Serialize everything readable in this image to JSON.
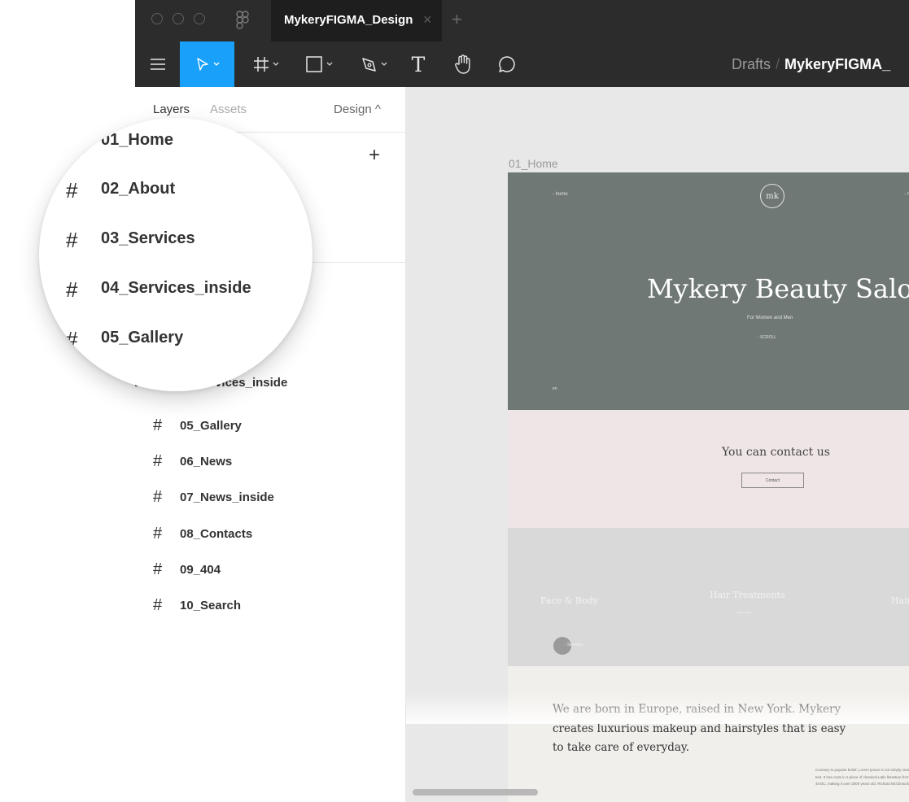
{
  "window": {
    "tab_title": "MykeryFIGMA_Design",
    "tab_close": "×",
    "tab_add": "+"
  },
  "toolbar": {
    "breadcrumb_parent": "Drafts",
    "breadcrumb_separator": "/",
    "breadcrumb_file": "MykeryFIGMA_",
    "text_tool_glyph": "T",
    "tools": [
      "menu-icon",
      "move-icon",
      "frame-icon",
      "shape-icon",
      "pen-icon",
      "text-icon",
      "hand-icon",
      "comment-icon"
    ]
  },
  "panel": {
    "tab_layers": "Layers",
    "tab_assets": "Assets",
    "tab_design": "Design ^",
    "add_page": "+"
  },
  "layers": [
    {
      "hash": "#",
      "label": "05_Gallery"
    },
    {
      "hash": "#",
      "label": "06_News"
    },
    {
      "hash": "#",
      "label": "07_News_inside"
    },
    {
      "hash": "#",
      "label": "08_Contacts"
    },
    {
      "hash": "#",
      "label": "09_404"
    },
    {
      "hash": "#",
      "label": "10_Search"
    }
  ],
  "partial_layer": "News  #  04_Services_inside",
  "magnifier": {
    "top_label": "01_Home",
    "items": [
      {
        "hash": "#",
        "label": "02_About"
      },
      {
        "hash": "#",
        "label": "03_Services"
      },
      {
        "hash": "#",
        "label": "04_Services_inside"
      },
      {
        "hash": "#",
        "label": "05_Gallery"
      }
    ]
  },
  "canvas": {
    "frame_label": "01_Home",
    "hero": {
      "nav_left": "- home",
      "nav_right": "- n",
      "logo": "mk",
      "title": "Mykery Beauty Salon",
      "subtitle": "For Women and Men",
      "scroll": "- SCROLL",
      "small": "en"
    },
    "contact": {
      "title": "You can contact us",
      "button": "Contact"
    },
    "services": {
      "item1": "Face & Body",
      "item2": "Hair Treatments",
      "item2_sub": "read more",
      "item3": "Hair",
      "more": "- Services"
    },
    "about": {
      "text": "We are born in Europe, raised in New York. Mykery creates luxurious makeup and hairstyles that is easy to take care of everyday.",
      "small": "Contrary to popular belief, Lorem Ipsum is not simply random text. It has roots in a piece of classical Latin literature from 45 BC, making it over 2000 years old. Richard McClintock."
    }
  },
  "colors": {
    "chrome": "#2c2c2c",
    "accent": "#18a0fb",
    "hero": "#6f7874",
    "contact": "#efe5e7",
    "services": "#d9d9d9",
    "about": "#f1efeb"
  }
}
